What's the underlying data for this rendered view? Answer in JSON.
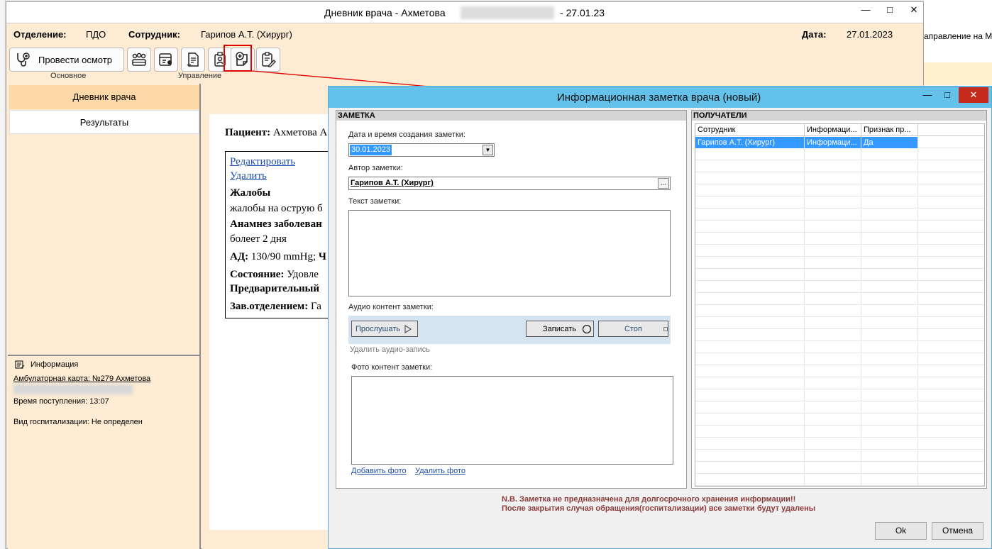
{
  "main_window": {
    "title_prefix": "Дневник врача - Ахметова",
    "title_date": "27.01.23",
    "controls": {
      "minimize": "—",
      "maximize": "□",
      "close": "✕"
    }
  },
  "header": {
    "department_label": "Отделение:",
    "department_value": "ПДО",
    "employee_label": "Сотрудник:",
    "employee_value": "Гарипов А.Т. (Хирург)",
    "date_label": "Дата:",
    "date_value": "27.01.2023"
  },
  "toolbar": {
    "exam_button_label": "Провести осмотр",
    "group_main_label": "Основное",
    "group_manage_label": "Управление",
    "icons": [
      "stethoscope-icon",
      "patients-group-icon",
      "patient-card-icon",
      "document-sign-icon",
      "badge-icon",
      "add-note-icon",
      "clipboard-edit-icon"
    ]
  },
  "left_panel": {
    "items": [
      {
        "label": "Дневник врача"
      },
      {
        "label": "Результаты"
      }
    ],
    "info": {
      "title": "Информация",
      "card": "Амбулаторная карта: №279 Ахметова",
      "admission_time": "Время поступления: 13:07",
      "hospitalization": "Вид госпитализации: Не определен"
    }
  },
  "document": {
    "patient_label": "Пациент:",
    "patient_value": "Ахметова А",
    "edit_link": "Редактировать",
    "delete_link": "Удалить",
    "complaints_label": "Жалобы",
    "complaints_value": "жалобы на острую б",
    "anamnesis_label": "Анамнез заболеван",
    "anamnesis_value": "болеет 2 дня",
    "bp_label": "АД:",
    "bp_value": "130/90 mmHg;",
    "bp_next": "Ч",
    "state_label": "Состояние:",
    "state_value": "Удовле",
    "preliminary_label": "Предварительный",
    "head_label": "Зав.отделением:",
    "head_value": "Га"
  },
  "right_background": {
    "text": "аправление на МС"
  },
  "dialog": {
    "title": "Информационная заметка врача (новый)",
    "controls": {
      "minimize": "—",
      "maximize": "□",
      "close": "✕"
    },
    "note": {
      "section_title": "ЗАМЕТКА",
      "date_label": "Дата и время создания заметки:",
      "date_value": "30.01.2023",
      "author_label": "Автор заметки:",
      "author_value": "Гарипов А.Т. (Хирург)",
      "author_browse": "...",
      "text_label": "Текст заметки:",
      "audio_label": "Аудио контент заметки:",
      "play_button": "Прослушать",
      "record_button": "Записать",
      "stop_button": "Стоп",
      "delete_audio": "Удалить аудио-запись",
      "photo_label": "Фото контент заметки:",
      "add_photo": "Добавить фото",
      "delete_photo": "Удалить фото"
    },
    "recipients": {
      "section_title": "ПОЛУЧАТЕЛИ",
      "columns": [
        "Сотрудник",
        "Информаци...",
        "Признак пр..."
      ],
      "rows": [
        [
          "Гарипов А.Т. (Хирург)",
          "Информаци...",
          "Да"
        ]
      ]
    },
    "warning_line1": "N.B. Заметка не предназначена для долгосрочного хранения информации!!",
    "warning_line2": "После закрытия случая обращения(госпитализации) все заметки будут удалены",
    "ok_button": "Ok",
    "cancel_button": "Отмена"
  },
  "colors": {
    "panel_bg": "#fdebd3",
    "active_item": "#fdd9a8",
    "dialog_title": "#63c1ea",
    "selection": "#3399ff",
    "annotation_red": "#e00000",
    "warning_text": "#8b3a3a"
  }
}
